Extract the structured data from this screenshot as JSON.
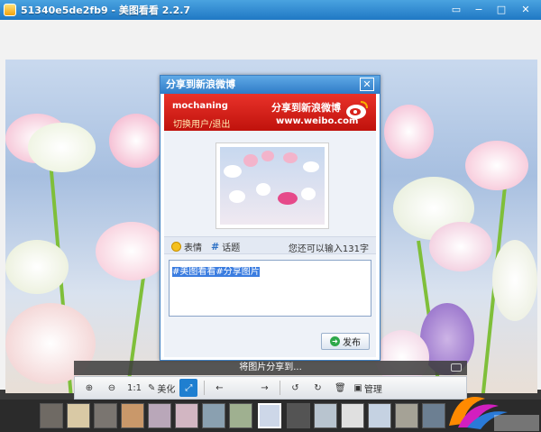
{
  "window": {
    "title": "51340e5de2fb9 - 美图看看 2.2.7",
    "restore_glyph": "▭",
    "minimize_glyph": "−",
    "maximize_glyph": "□",
    "close_glyph": "✕"
  },
  "dialog": {
    "title": "分享到新浪微博",
    "close_glyph": "✕",
    "banner": {
      "username": "mochaning",
      "switch_link": "切换用户/退出",
      "slogan": "分享到新浪微博",
      "url": "www.weibo.com"
    },
    "tools": {
      "emoji_label": "表情",
      "topic_label": "话题",
      "topic_glyph": "#",
      "char_count": "您还可以输入131字"
    },
    "text_value": "#美图看看#分享图片",
    "send_label": "发布",
    "send_glyph": "➜"
  },
  "status_text": "将图片分享到...",
  "toolbar": {
    "zoom_in": "⊕",
    "zoom_out": "⊖",
    "actual_size": "1:1",
    "beautify_label": "美化",
    "fit": "⤢",
    "prev": "←",
    "next": "→",
    "rotate_left": "↺",
    "rotate_right": "↻",
    "delete": "🗑",
    "manage_label": "管理"
  },
  "colors": {
    "titlebar": "#2f87d4",
    "banner_red": "#d8221b",
    "selected_tool": "#1f7fd0"
  }
}
